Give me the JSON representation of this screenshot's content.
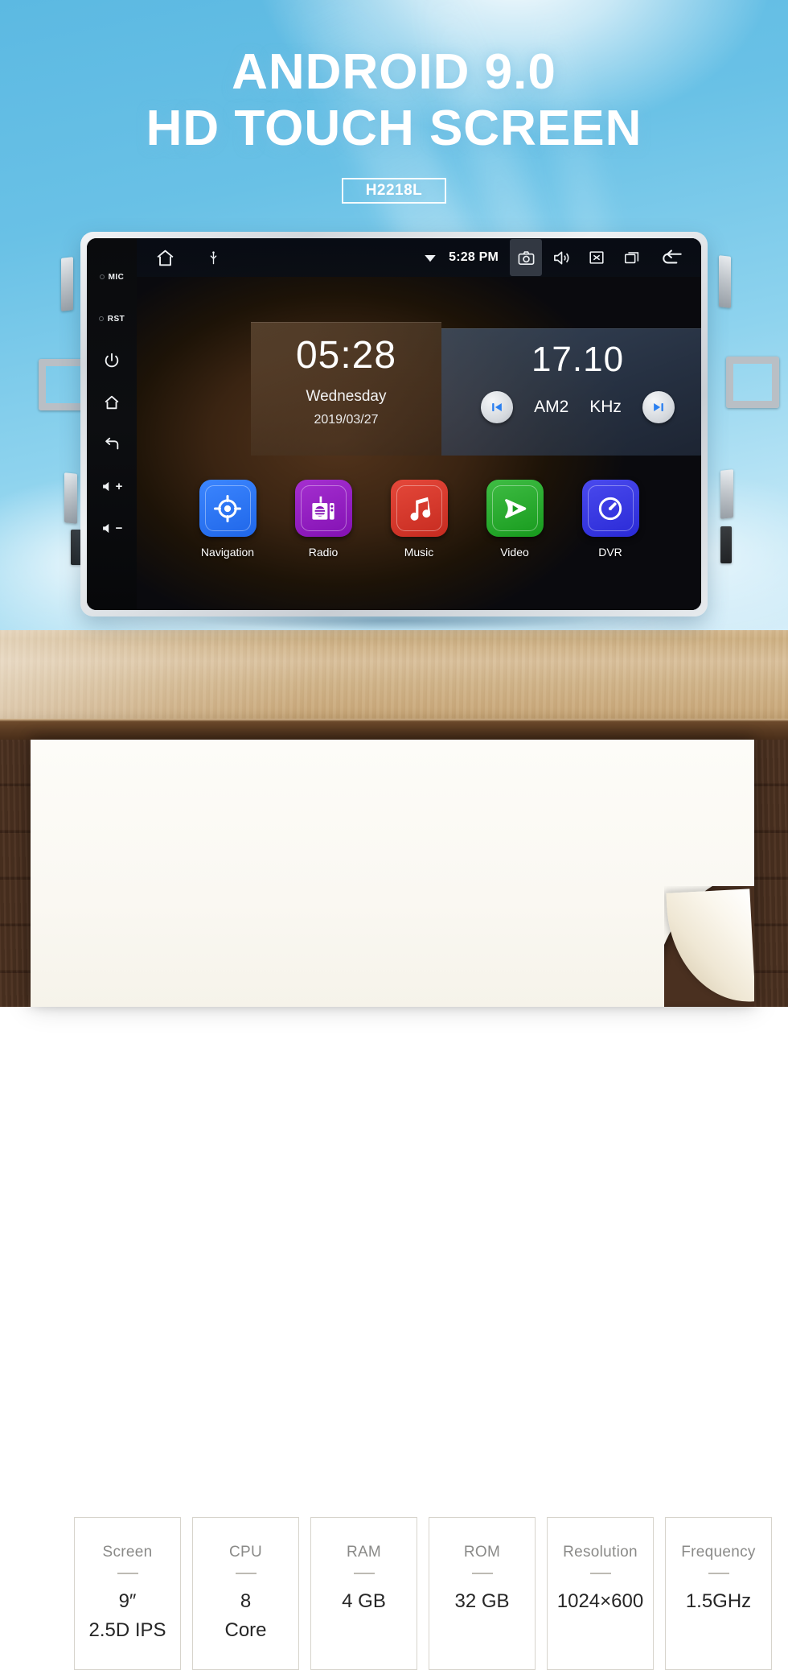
{
  "header": {
    "line1": "ANDROID 9.0",
    "line2": "HD TOUCH SCREEN",
    "model": "H2218L"
  },
  "device": {
    "side_buttons": [
      {
        "name": "mic",
        "label": "MIC",
        "type": "pin"
      },
      {
        "name": "reset",
        "label": "RST",
        "type": "pin"
      },
      {
        "name": "power",
        "label": "",
        "type": "icon"
      },
      {
        "name": "home",
        "label": "",
        "type": "icon"
      },
      {
        "name": "back",
        "label": "",
        "type": "icon"
      },
      {
        "name": "volume-up",
        "label": "+",
        "type": "icon"
      },
      {
        "name": "volume-down",
        "label": "−",
        "type": "icon"
      }
    ],
    "statusbar": {
      "time": "5:28 PM",
      "left_icons": [
        "home-icon",
        "usb-icon"
      ],
      "right_icons": [
        "wifi-icon",
        "camera-icon",
        "volume-icon",
        "close-icon",
        "recents-icon",
        "back-icon"
      ]
    },
    "clock_widget": {
      "time": "05:28",
      "weekday": "Wednesday",
      "date": "2019/03/27"
    },
    "radio_widget": {
      "frequency": "17.10",
      "band": "AM2",
      "unit": "KHz",
      "prev_label": "skip-previous-icon",
      "next_label": "skip-next-icon"
    },
    "apps": [
      {
        "label": "Navigation",
        "icon": "navigation-target-icon",
        "color": "#2a73f0"
      },
      {
        "label": "Radio",
        "icon": "radio-receiver-icon",
        "color": "#9220bd"
      },
      {
        "label": "Music",
        "icon": "music-note-icon",
        "color": "#d8392c"
      },
      {
        "label": "Video",
        "icon": "video-play-icon",
        "color": "#23a32b"
      },
      {
        "label": "DVR",
        "icon": "gauge-icon",
        "color": "#3a3ae0"
      }
    ]
  },
  "specs": [
    {
      "label": "Screen",
      "value": "9″\n2.5D IPS"
    },
    {
      "label": "CPU",
      "value": "8\nCore"
    },
    {
      "label": "RAM",
      "value": "4 GB"
    },
    {
      "label": "ROM",
      "value": "32 GB"
    },
    {
      "label": "Resolution",
      "value": "1024×600"
    },
    {
      "label": "Frequency",
      "value": "1.5GHz"
    }
  ]
}
